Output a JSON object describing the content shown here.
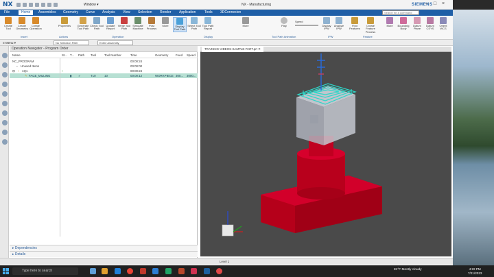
{
  "app": {
    "logo": "NX",
    "window_title": "NX - Manufacturing",
    "brand": "SIEMENS",
    "window_menu": "Window"
  },
  "menu": [
    "File",
    "Home",
    "Assemblies",
    "Geometry",
    "Curve",
    "Analysis",
    "View",
    "Selection",
    "Render",
    "Application",
    "Tools",
    "3DConnexion"
  ],
  "active_menu": "Home",
  "command_search": {
    "placeholder": "Search for a command"
  },
  "ribbon": {
    "buttons": [
      "Create Tool",
      "Create Geometry",
      "Create Operation",
      "Properties",
      "Generate Tool Path",
      "Check Tool Path",
      "Update Report",
      "Verify Tool Path",
      "Simulate Machine",
      "Post Process",
      "More",
      "Display Tool Path",
      "Select Tool Path",
      "Tool Path Report",
      "More",
      "Play",
      "Speed",
      "Display IPW",
      "Analyze IPW",
      "Find Features",
      "Create Feature Process",
      "More",
      "Bounding Body",
      "Datum Plane",
      "Datum CSYS",
      "Orient WCS"
    ],
    "groups": [
      "Insert",
      "Actions",
      "Operation",
      "Display",
      "Tool Path Animation",
      "IPW",
      "Feature"
    ]
  },
  "filter_bar": {
    "menu": "Menu",
    "filter": "No Selection Filter",
    "assembly": "Entire Assembly"
  },
  "navigator": {
    "title": "Operation Navigator - Program Order",
    "columns": [
      "Name",
      "St...",
      "T...",
      "Path",
      "Tool",
      "Tool Number",
      "Time",
      "Geometry",
      "Feed",
      "Speed"
    ],
    "rows": [
      {
        "name": "NC_PROGRAM",
        "time": "00:00:24",
        "indent": 0
      },
      {
        "name": "Unused Items",
        "time": "00:00:00",
        "indent": 1
      },
      {
        "name": "1Q1",
        "time": "00:00:24",
        "indent": 1
      },
      {
        "name": "FACE_MILLING",
        "tool": "T10",
        "tool_number": "10",
        "time": "00:00:12",
        "geometry": "WORKPIECE",
        "feed": "300...",
        "speed": "3000...",
        "indent": 2
      }
    ],
    "panels": [
      "Dependencies",
      "Details"
    ]
  },
  "viewport": {
    "tab": "TRAINING-VIDEOS-SAMPLE-PART.prt"
  },
  "status": {
    "text": "Level 1"
  },
  "taskbar": {
    "search_placeholder": "Type here to search",
    "weather": "81°F Mostly cloudy",
    "time": "4:22 PM",
    "date": "7/21/2023"
  },
  "colors": {
    "accent": "#1f5fa7",
    "part_red": "#c1001a",
    "selection_teal": "#2fd6c8",
    "viewport_bg": "#4a4a4a"
  }
}
